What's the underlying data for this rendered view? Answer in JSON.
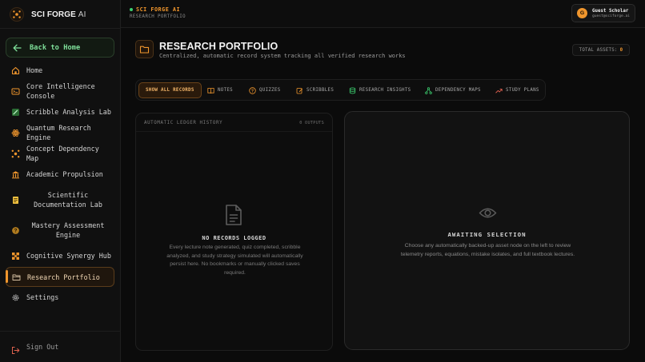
{
  "brand": {
    "name": "SCI FORGE",
    "suffix": "AI"
  },
  "sidebar": {
    "back_label": "Back to Home",
    "items": [
      {
        "label": "Home",
        "icon": "home-icon"
      },
      {
        "label": "Core Intelligence Console",
        "icon": "console-icon"
      },
      {
        "label": "Scribble Analysis Lab",
        "icon": "scribble-icon"
      },
      {
        "label": "Quantum Research Engine",
        "icon": "atom-icon"
      },
      {
        "label": "Concept Dependency Map",
        "icon": "network-icon"
      },
      {
        "label": "Academic Propulsion",
        "icon": "building-icon"
      },
      {
        "label": "Scientific Documentation Lab",
        "icon": "document-icon"
      },
      {
        "label": "Mastery Assessment Engine",
        "icon": "question-icon"
      },
      {
        "label": "Cognitive Synergy Hub",
        "icon": "hub-icon"
      },
      {
        "label": "Research Portfolio",
        "icon": "folder-icon"
      },
      {
        "label": "Settings",
        "icon": "gear-icon"
      }
    ],
    "active_index": 9,
    "signout_label": "Sign Out"
  },
  "topbar": {
    "status": "SCI FORGE AI",
    "breadcrumb": "RESEARCH PORTFOLIO",
    "user": {
      "initial": "G",
      "name": "Guest Scholar",
      "email": "guest@sciforge.ai"
    }
  },
  "header": {
    "title": "RESEARCH PORTFOLIO",
    "subtitle": "Centralized, automatic record system tracking all verified research works",
    "assets_label": "TOTAL ASSETS:",
    "assets_count": "0"
  },
  "tabs": [
    {
      "label": "SHOW ALL RECORDS",
      "active": true
    },
    {
      "label": "NOTES",
      "icon": "book-icon"
    },
    {
      "label": "QUIZZES",
      "icon": "question-icon"
    },
    {
      "label": "SCRIBBLES",
      "icon": "edit-icon"
    },
    {
      "label": "RESEARCH INSIGHTS",
      "icon": "database-icon"
    },
    {
      "label": "DEPENDENCY MAPS",
      "icon": "network-icon"
    },
    {
      "label": "STUDY PLANS",
      "icon": "trend-icon"
    }
  ],
  "ledger": {
    "title": "AUTOMATIC LEDGER HISTORY",
    "count": "0 OUTPUTS",
    "empty_title": "NO RECORDS LOGGED",
    "empty_desc": "Every lecture note generated, quiz completed, scribble analyzed, and study strategy simulated will automatically persist here. No bookmarks or manually clicked saves required."
  },
  "detail": {
    "title": "AWAITING SELECTION",
    "desc": "Choose any automatically backed-up asset node on the left to review telemetry reports, equations, mistake isolates, and full textbook lectures."
  },
  "colors": {
    "accent": "#f0962d",
    "green": "#7fe09a",
    "bg": "#0b0b0b"
  }
}
